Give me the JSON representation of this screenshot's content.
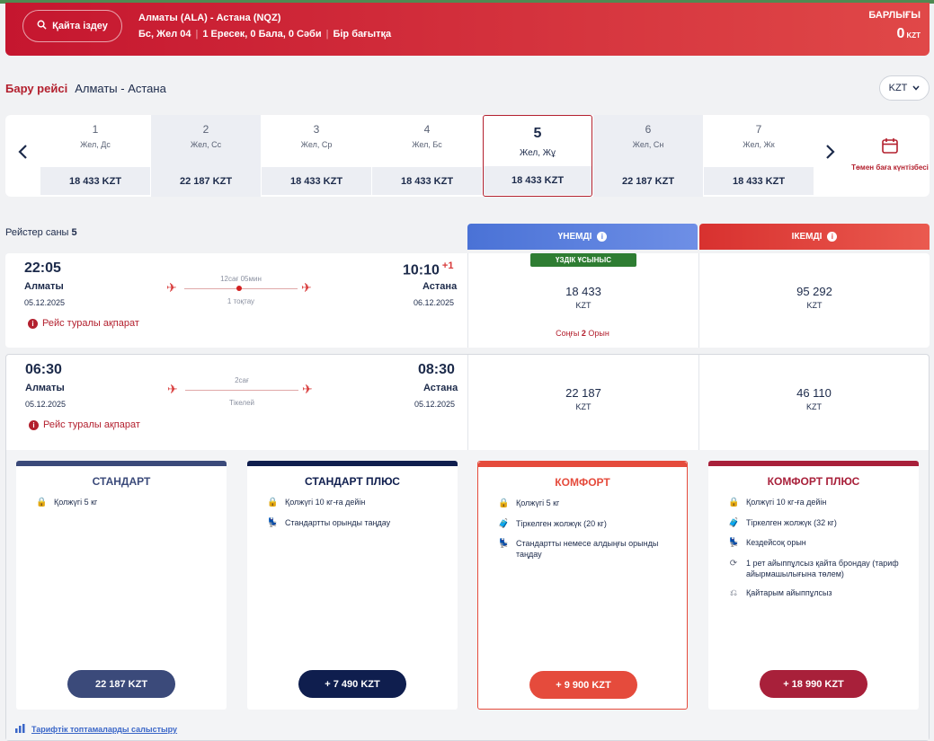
{
  "header": {
    "search_label": "Қайта іздеу",
    "route": "Алматы (ALA) - Астана (NQZ)",
    "date": "Бс, Жел 04",
    "passengers": "1 Ересек, 0 Бала, 0 Сәби",
    "trip_type": "Бір бағытқа",
    "total_label": "БАРЛЫҒЫ",
    "total_value": "0",
    "total_currency": "KZT"
  },
  "departure": {
    "label": "Бару рейсі",
    "route": "Алматы - Астана"
  },
  "currency": {
    "selected": "KZT"
  },
  "dates": [
    {
      "num": "1",
      "day": "Жел, Дс",
      "price": "18 433 KZT"
    },
    {
      "num": "2",
      "day": "Жел, Сс",
      "price": "22 187 KZT"
    },
    {
      "num": "3",
      "day": "Жел, Ср",
      "price": "18 433 KZT"
    },
    {
      "num": "4",
      "day": "Жел, Бс",
      "price": "18 433 KZT"
    },
    {
      "num": "5",
      "day": "Жел, Жұ",
      "price": "18 433 KZT"
    },
    {
      "num": "6",
      "day": "Жел, Сн",
      "price": "22 187 KZT"
    },
    {
      "num": "7",
      "day": "Жел, Жк",
      "price": "18 433 KZT"
    }
  ],
  "calendar_label": "Төмен баға күнтізбесі",
  "flights_count_label": "Рейстер саны",
  "flights_count": "5",
  "columns": {
    "economy": "ҮНЕМДІ",
    "business": "ІКЕМДІ"
  },
  "flights": [
    {
      "dep_time": "22:05",
      "dep_city": "Алматы",
      "dep_date": "05.12.2025",
      "arr_time": "10:10",
      "arr_plus": "+1",
      "arr_city": "Астана",
      "arr_date": "06.12.2025",
      "duration": "12сағ 05мин",
      "stops": "1 тоқтау",
      "info": "Рейс туралы ақпарат",
      "eco_price": "18 433",
      "eco_cur": "KZT",
      "biz_price": "95 292",
      "biz_cur": "KZT",
      "best_label": "ҮЗДІК ҰСЫНЫС",
      "last_seats_pre": "Соңғы",
      "last_seats_num": "2",
      "last_seats_post": "Орын"
    },
    {
      "dep_time": "06:30",
      "dep_city": "Алматы",
      "dep_date": "05.12.2025",
      "arr_time": "08:30",
      "arr_city": "Астана",
      "arr_date": "05.12.2025",
      "duration": "2сағ",
      "stops": "Тікелей",
      "info": "Рейс туралы ақпарат",
      "eco_price": "22 187",
      "eco_cur": "KZT",
      "biz_price": "46 110",
      "biz_cur": "KZT"
    }
  ],
  "tariffs": [
    {
      "name": "СТАНДАРТ",
      "color": "#3b4a7a",
      "button": "22 187 KZT",
      "features": [
        {
          "icon": "bag-icon",
          "text": "Қолжүгі 5 кг"
        }
      ]
    },
    {
      "name": "СТАНДАРТ ПЛЮС",
      "color": "#0f1e4e",
      "button": "+ 7 490 KZT",
      "features": [
        {
          "icon": "bag-icon",
          "text": "Қолжүгі 10 кг-ға дейін"
        },
        {
          "icon": "seat-icon",
          "text": "Стандартты орынды таңдау"
        }
      ]
    },
    {
      "name": "КОМФОРТ",
      "color": "#e54b3c",
      "button": "+ 9 900 KZT",
      "features": [
        {
          "icon": "bag-icon",
          "text": "Қолжүгі 5 кг"
        },
        {
          "icon": "luggage-icon",
          "text": "Тіркелген жолжүк (20 кг)"
        },
        {
          "icon": "seat-icon",
          "text": "Стандартты немесе алдыңғы орынды таңдау"
        }
      ]
    },
    {
      "name": "КОМФОРТ ПЛЮС",
      "color": "#a8203a",
      "button": "+ 18 990 KZT",
      "features": [
        {
          "icon": "bag-icon",
          "text": "Қолжүгі 10 кг-ға дейін"
        },
        {
          "icon": "luggage-icon",
          "text": "Тіркелген жолжүк (32 кг)"
        },
        {
          "icon": "seat-icon",
          "text": "Кездейсоқ орын"
        },
        {
          "icon": "refresh-icon",
          "text": "1 рет айыппұлсыз қайта брондау (тариф айырмашылығына төлем)"
        },
        {
          "icon": "refund-icon",
          "text": "Қайтарым айыппұлсыз"
        }
      ]
    }
  ],
  "compare_label": "Тарифтік топтамаларды салыстыру"
}
